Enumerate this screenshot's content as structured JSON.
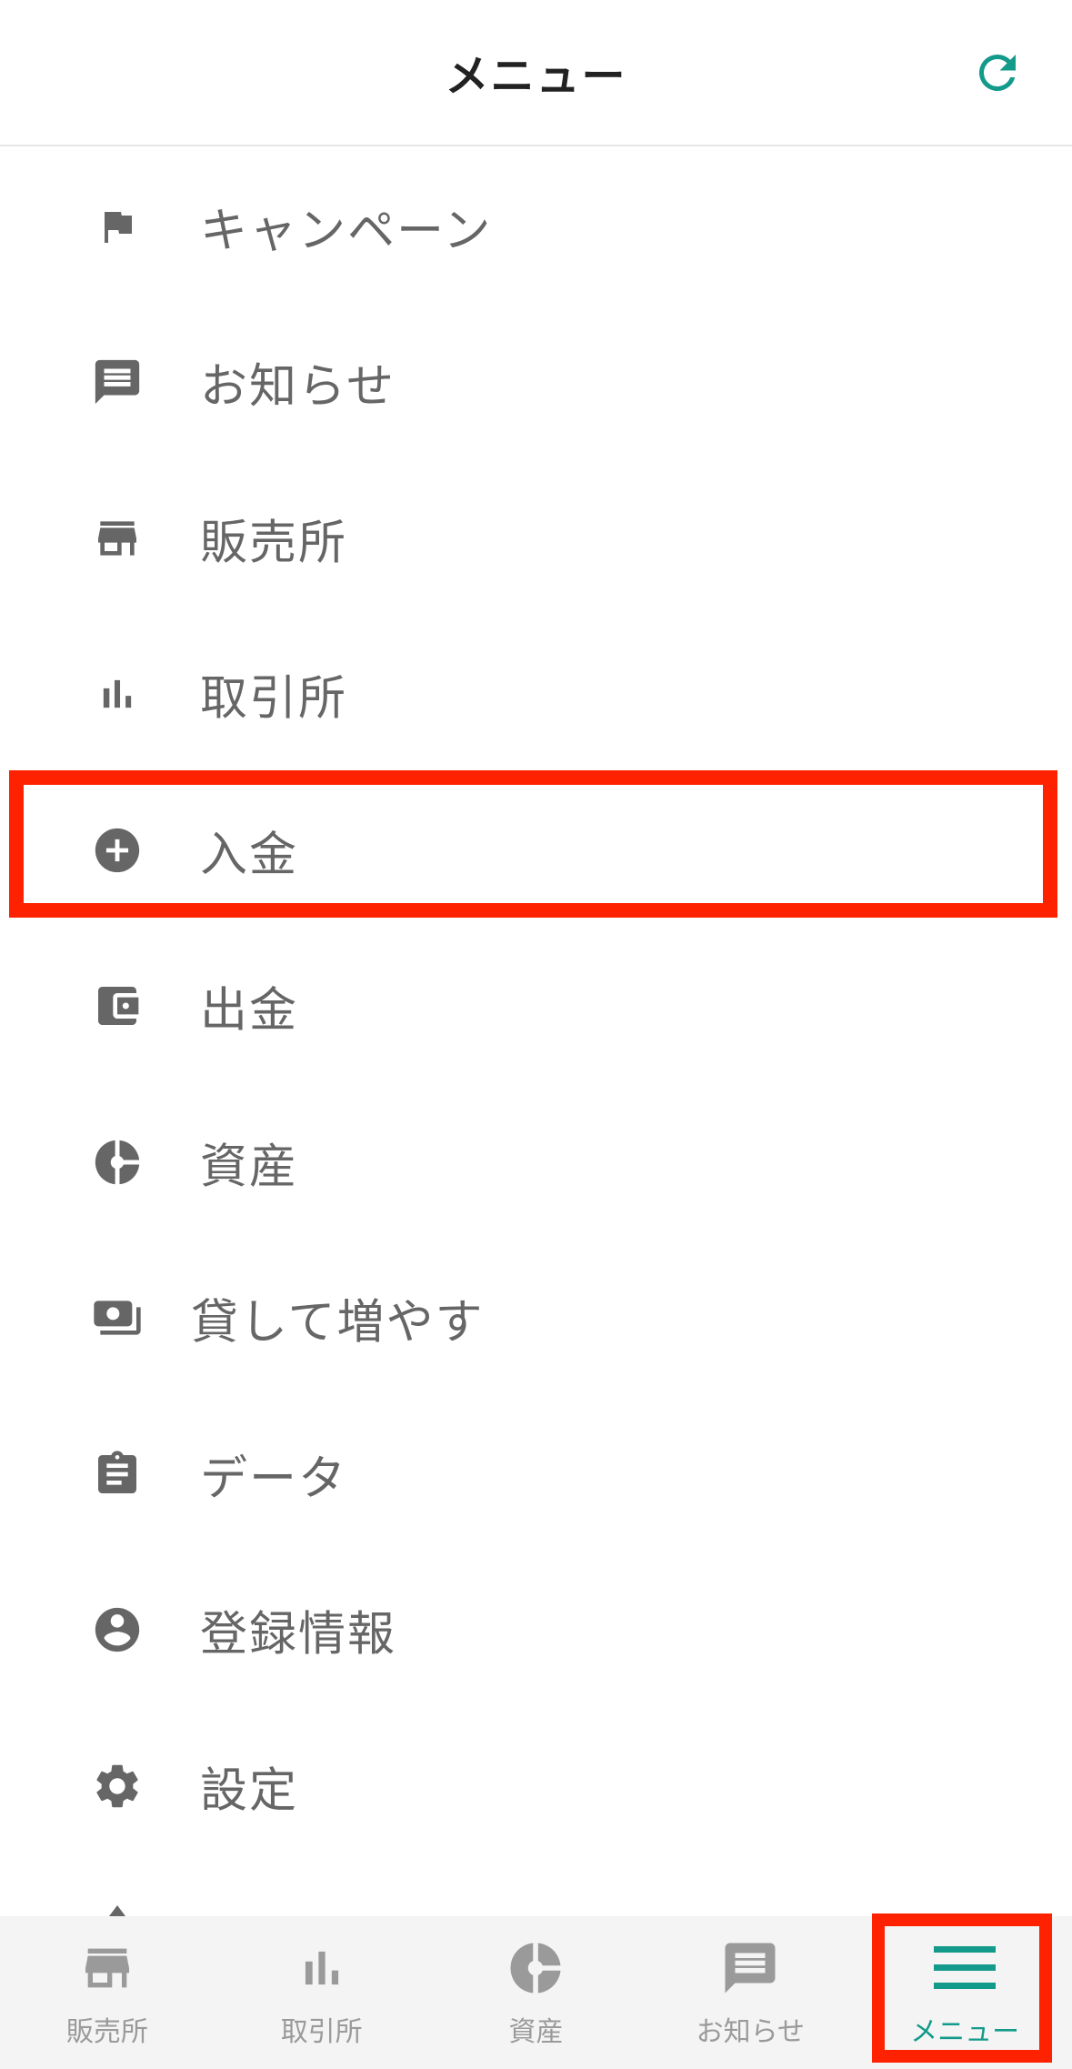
{
  "header": {
    "title": "メニュー",
    "refresh_icon": "refresh-icon",
    "accent": "#149a8a"
  },
  "menu": {
    "items": [
      {
        "label": "キャンペーン",
        "icon": "flag-icon"
      },
      {
        "label": "お知らせ",
        "icon": "message-icon"
      },
      {
        "label": "販売所",
        "icon": "store-icon"
      },
      {
        "label": "取引所",
        "icon": "bar-chart-icon"
      },
      {
        "label": "入金",
        "icon": "add-circle-icon"
      },
      {
        "label": "出金",
        "icon": "wallet-icon"
      },
      {
        "label": "資産",
        "icon": "pie-chart-icon"
      },
      {
        "label": "貸して増やす",
        "icon": "lend-icon"
      },
      {
        "label": "データ",
        "icon": "clipboard-icon"
      },
      {
        "label": "登録情報",
        "icon": "account-icon"
      },
      {
        "label": "設定",
        "icon": "gear-icon"
      }
    ],
    "highlight_color": "#ff2200"
  },
  "bottom_nav": {
    "tabs": [
      {
        "label": "販売所",
        "icon": "store-icon"
      },
      {
        "label": "取引所",
        "icon": "bar-chart-icon"
      },
      {
        "label": "資産",
        "icon": "pie-chart-icon"
      },
      {
        "label": "お知らせ",
        "icon": "message-icon"
      },
      {
        "label": "メニュー",
        "icon": "hamburger-menu-icon"
      }
    ],
    "active_tab": "メニュー",
    "inactive_color": "#9a9a9a",
    "active_color": "#149a8a"
  }
}
